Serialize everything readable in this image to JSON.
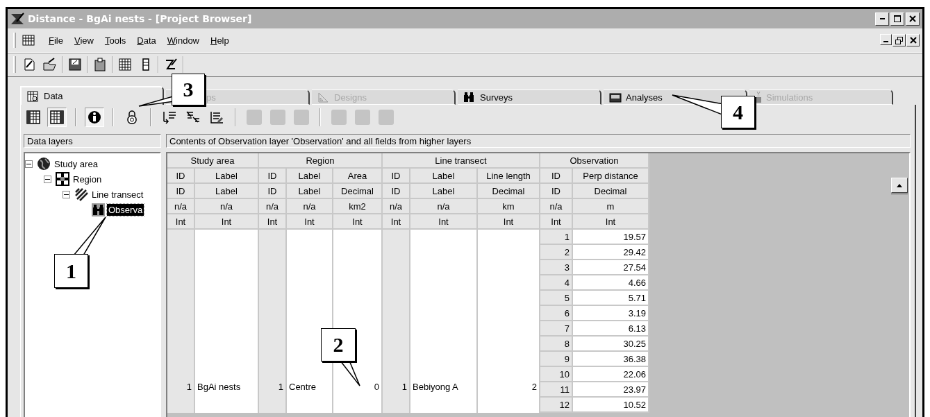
{
  "window": {
    "title": "Distance - BgAi nests - [Project Browser]"
  },
  "menu": [
    "File",
    "View",
    "Tools",
    "Data",
    "Window",
    "Help"
  ],
  "tabs": [
    {
      "label": "Data",
      "selected": true,
      "disabled": false
    },
    {
      "label": "ps",
      "selected": false,
      "disabled": true
    },
    {
      "label": "Designs",
      "selected": false,
      "disabled": true
    },
    {
      "label": "Surveys",
      "selected": false,
      "disabled": false
    },
    {
      "label": "Analyses",
      "selected": false,
      "disabled": false
    },
    {
      "label": "Simulations",
      "selected": false,
      "disabled": true
    }
  ],
  "inner_toolbar": [
    {
      "pressed": false,
      "disabled": false
    },
    {
      "pressed": true,
      "disabled": false
    },
    {
      "pressed": true,
      "disabled": false
    },
    {
      "pressed": false,
      "disabled": false
    },
    {
      "pressed": false,
      "disabled": false
    },
    {
      "pressed": false,
      "disabled": false
    },
    {
      "pressed": false,
      "disabled": false
    },
    {
      "pressed": false,
      "disabled": true
    },
    {
      "pressed": false,
      "disabled": true
    },
    {
      "pressed": false,
      "disabled": true
    },
    {
      "pressed": false,
      "disabled": true
    },
    {
      "pressed": false,
      "disabled": true
    },
    {
      "pressed": false,
      "disabled": true
    }
  ],
  "data_layers": {
    "header": "Data layers",
    "tree": [
      {
        "label": "Study area",
        "expanded": true,
        "selected": false,
        "children": [
          {
            "label": "Region",
            "expanded": true,
            "selected": false,
            "children": [
              {
                "label": "Line transect",
                "expanded": true,
                "selected": false,
                "children": [
                  {
                    "label": "Observa",
                    "selected": true
                  }
                ]
              }
            ]
          }
        ]
      }
    ]
  },
  "table": {
    "caption": "Contents of Observation layer 'Observation' and all fields from higher layers",
    "groups": [
      {
        "title": "Study area",
        "columns": [
          {
            "name": "ID",
            "type": "ID",
            "units": "n/a",
            "format": "Int"
          },
          {
            "name": "Label",
            "type": "Label",
            "units": "n/a",
            "format": "Int"
          }
        ]
      },
      {
        "title": "Region",
        "columns": [
          {
            "name": "ID",
            "type": "ID",
            "units": "n/a",
            "format": "Int"
          },
          {
            "name": "Label",
            "type": "Label",
            "units": "n/a",
            "format": "Int"
          },
          {
            "name": "Area",
            "type": "Decimal",
            "units": "km2",
            "format": "Int"
          }
        ]
      },
      {
        "title": "Line transect",
        "columns": [
          {
            "name": "ID",
            "type": "ID",
            "units": "n/a",
            "format": "Int"
          },
          {
            "name": "Label",
            "type": "Label",
            "units": "n/a",
            "format": "Int"
          },
          {
            "name": "Line length",
            "type": "Decimal",
            "units": "km",
            "format": "Int"
          }
        ]
      },
      {
        "title": "Observation",
        "columns": [
          {
            "name": "ID",
            "type": "ID",
            "units": "n/a",
            "format": "Int"
          },
          {
            "name": "Perp distance",
            "type": "Decimal",
            "units": "m",
            "format": "Int"
          }
        ]
      }
    ],
    "upper_values": [
      "1",
      "BgAi nests",
      "1",
      "Centre",
      "0",
      "1",
      "Bebiyong A",
      "2"
    ],
    "rows": [
      {
        "id": "1",
        "perp_distance": "19.57"
      },
      {
        "id": "2",
        "perp_distance": "29.42"
      },
      {
        "id": "3",
        "perp_distance": "27.54"
      },
      {
        "id": "4",
        "perp_distance": "4.66"
      },
      {
        "id": "5",
        "perp_distance": "5.71"
      },
      {
        "id": "6",
        "perp_distance": "3.19"
      },
      {
        "id": "7",
        "perp_distance": "6.13"
      },
      {
        "id": "8",
        "perp_distance": "30.25"
      },
      {
        "id": "9",
        "perp_distance": "36.38"
      },
      {
        "id": "10",
        "perp_distance": "22.06"
      },
      {
        "id": "11",
        "perp_distance": "23.97"
      },
      {
        "id": "12",
        "perp_distance": "10.52"
      }
    ]
  },
  "callouts": [
    {
      "label": "3"
    },
    {
      "label": "4"
    },
    {
      "label": "1"
    },
    {
      "label": "2"
    }
  ]
}
